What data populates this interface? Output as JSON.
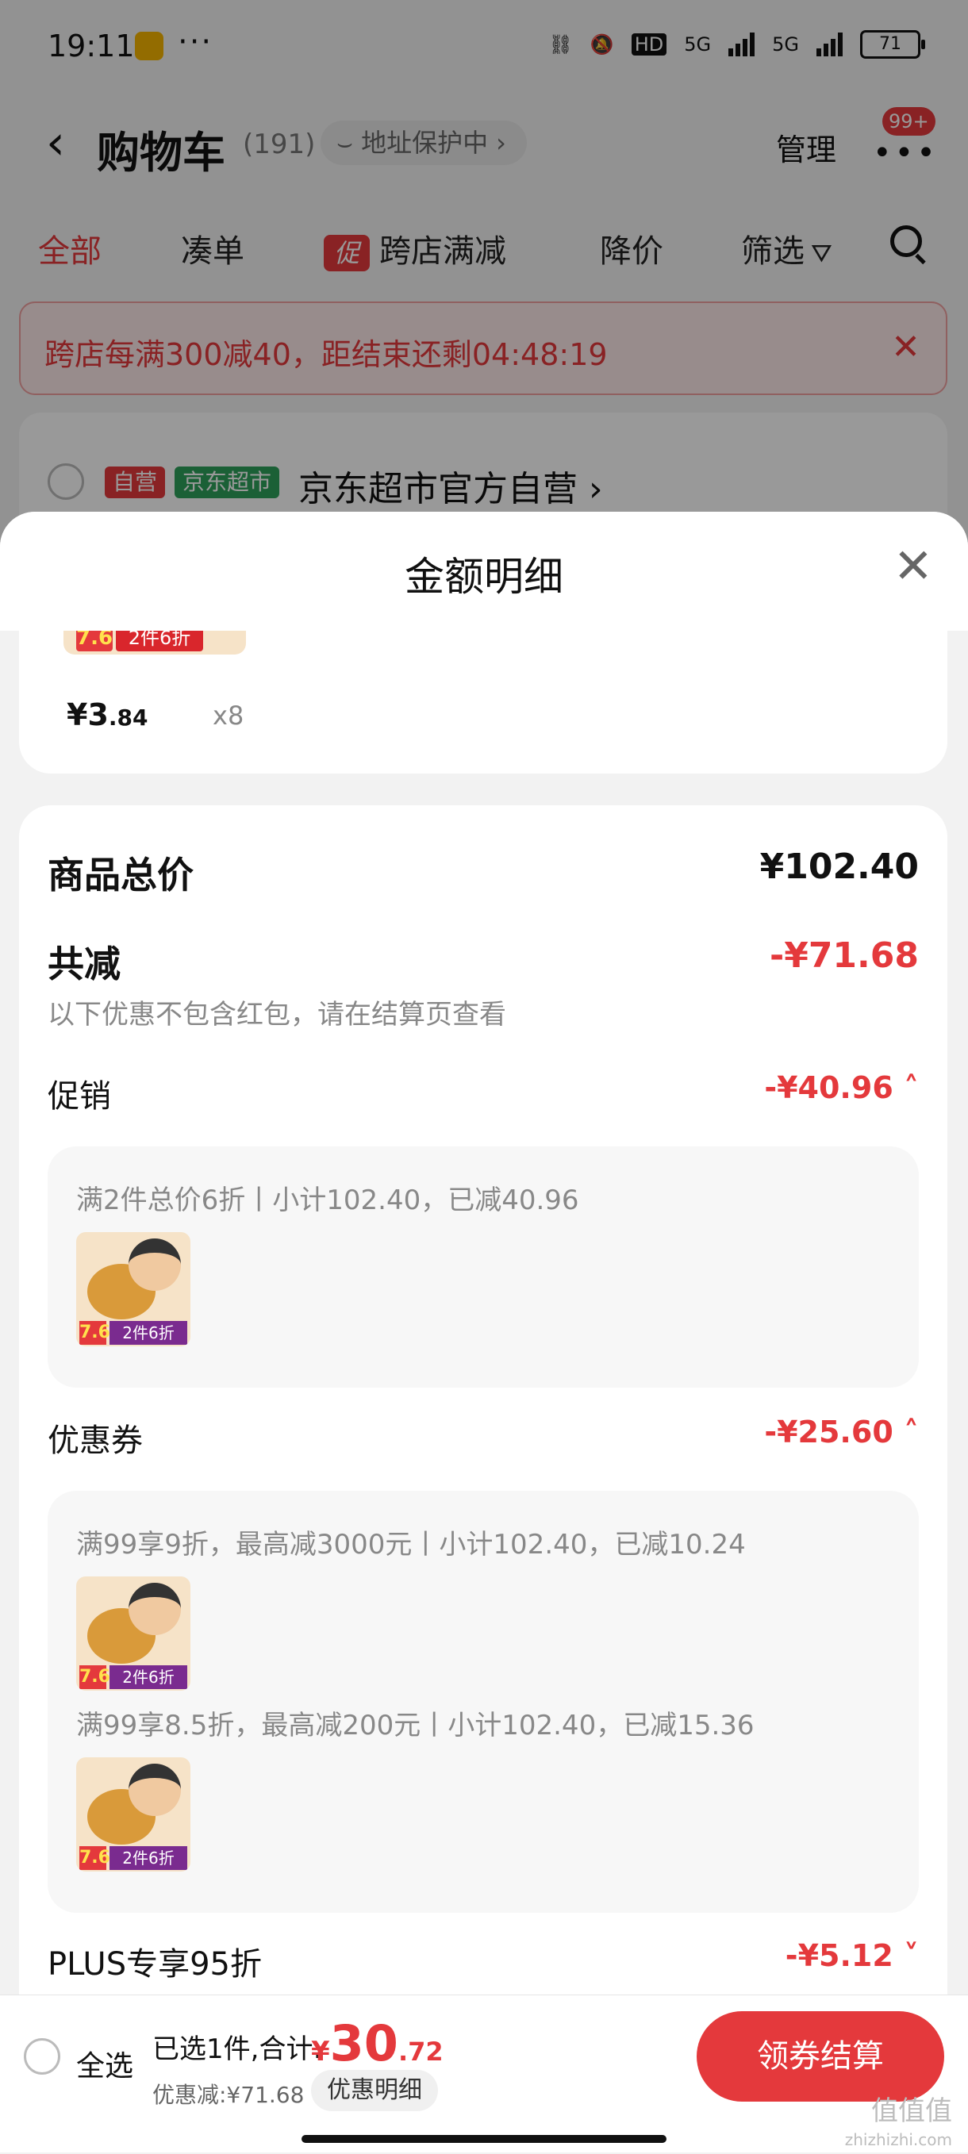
{
  "status_bar": {
    "time": "19:11",
    "more": "···",
    "network": "HD",
    "sig1": "5G",
    "sig2": "5G",
    "battery": "71"
  },
  "nav": {
    "title": "购物车",
    "count": "(191)",
    "address_protect": "地址保护中",
    "manage": "管理",
    "badge": "99+"
  },
  "tabs": [
    {
      "label": "全部",
      "active": true
    },
    {
      "label": "凑单"
    },
    {
      "label": "跨店满减",
      "tag": "促"
    },
    {
      "label": "降价"
    },
    {
      "label": "筛选"
    }
  ],
  "promo_banner": {
    "text": "跨店每满300减40，距结束还剩04:48:19"
  },
  "store": {
    "self_badge": "自营",
    "market_badge": "京东超市",
    "name": "京东超市官方自营"
  },
  "sheet": {
    "title": "金额明细",
    "item": {
      "thumb_seven": "7.6",
      "thumb_discount": "2件6折",
      "price_symbol": "¥",
      "price_int": "3",
      "price_dec": ".84",
      "qty": "x8"
    },
    "total_label": "商品总价",
    "total_value": "¥102.40",
    "reduce_label": "共减",
    "reduce_value": "-¥71.68",
    "reduce_note": "以下优惠不包含红包，请在结算页查看",
    "sections": [
      {
        "label": "促销",
        "value": "-¥40.96",
        "lines": [
          "满2件总价6折丨小计102.40，已减40.96"
        ]
      },
      {
        "label": "优惠券",
        "value": "-¥25.60",
        "lines": [
          "满99享9折，最高减3000元丨小计102.40，已减10.24",
          "满99享8.5折，最高减200元丨小计102.40，已减15.36"
        ]
      },
      {
        "label": "PLUS专享95折",
        "value": "-¥5.12"
      }
    ],
    "thumb_seven": "7.6",
    "thumb_discount": "2件6折"
  },
  "footer": {
    "select_all": "全选",
    "selected": "已选1件,合计:",
    "total_symbol": "¥",
    "total_int": "30",
    "total_dec": ".72",
    "discount": "优惠减:¥71.68",
    "detail_button": "优惠明细",
    "checkout": "领券结算",
    "watermark": "值值值",
    "watermark_url": "zhizhizhi.com"
  }
}
